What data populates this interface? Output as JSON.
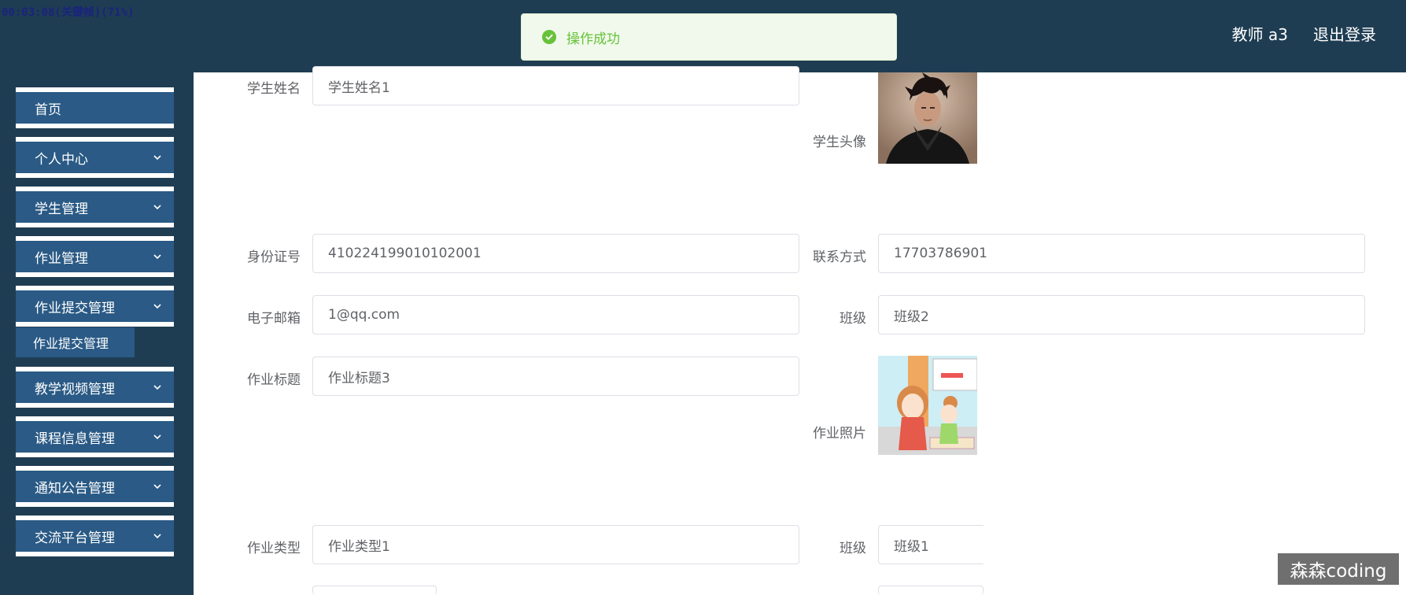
{
  "overlay": {
    "recording": "00:03:08(关键帧)(71%)"
  },
  "header": {
    "user": "教师 a3",
    "logout": "退出登录"
  },
  "toast": {
    "message": "操作成功"
  },
  "sidebar": {
    "items": [
      {
        "label": "首页"
      },
      {
        "label": "个人中心"
      },
      {
        "label": "学生管理"
      },
      {
        "label": "作业管理"
      },
      {
        "label": "作业提交管理"
      },
      {
        "label": "教学视频管理"
      },
      {
        "label": "课程信息管理"
      },
      {
        "label": "通知公告管理"
      },
      {
        "label": "交流平台管理"
      }
    ],
    "sub_item": {
      "label": "作业提交管理"
    }
  },
  "form": {
    "student_name": {
      "label": "学生姓名",
      "value": "学生姓名1"
    },
    "avatar": {
      "label": "学生头像"
    },
    "id_number": {
      "label": "身份证号",
      "value": "410224199010102001"
    },
    "contact": {
      "label": "联系方式",
      "value": "17703786901"
    },
    "email": {
      "label": "电子邮箱",
      "value": "1@qq.com"
    },
    "class_1": {
      "label": "班级",
      "value": "班级2"
    },
    "homework_title": {
      "label": "作业标题",
      "value": "作业标题3"
    },
    "homework_photo": {
      "label": "作业照片"
    },
    "homework_type": {
      "label": "作业类型",
      "value": "作业类型1"
    },
    "class_2": {
      "label": "班级",
      "value": "班级1"
    }
  },
  "watermark": {
    "text": "森森coding"
  },
  "colors": {
    "header_bg": "#1f3d52",
    "menu_bg": "#2a5a85",
    "success": "#67c23a"
  }
}
